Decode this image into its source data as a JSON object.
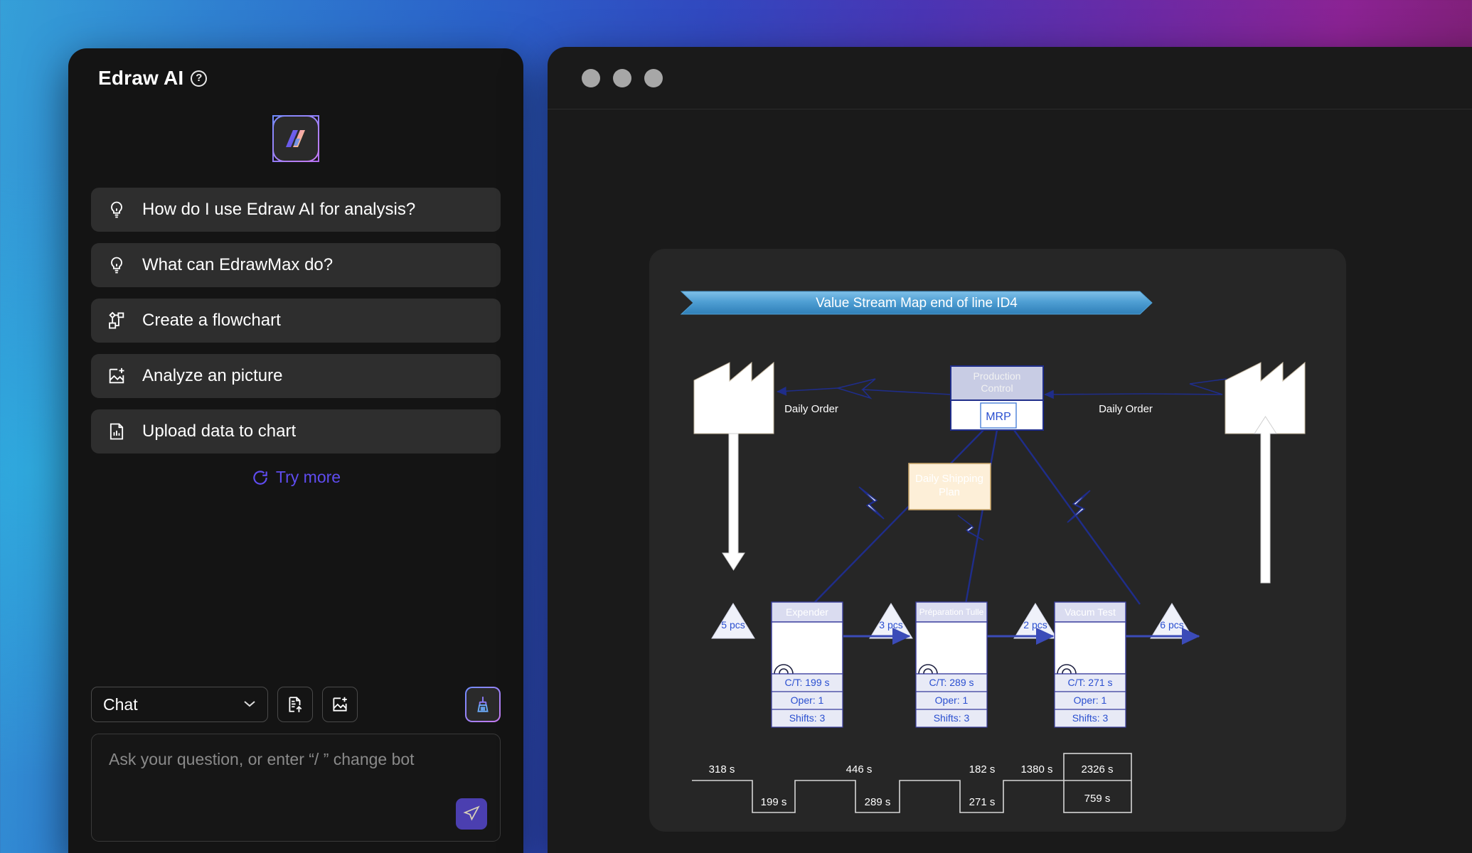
{
  "background": {
    "gradient_from": "#35a0d8",
    "gradient_mid": "#4a35b4",
    "gradient_to": "#5e1a50"
  },
  "ai_panel": {
    "title": "Edraw AI",
    "help_icon": "question-mark-icon",
    "logo_icon": "edraw-ai-logo-icon",
    "suggestions": [
      {
        "label": "How do I use Edraw AI for analysis?",
        "icon": "lightbulb-icon"
      },
      {
        "label": "What can EdrawMax do?",
        "icon": "lightbulb-icon"
      },
      {
        "label": "Create a flowchart",
        "icon": "flowchart-icon"
      },
      {
        "label": "Analyze an picture",
        "icon": "image-add-icon"
      },
      {
        "label": "Upload data to chart",
        "icon": "chart-file-icon"
      }
    ],
    "try_more": {
      "label": "Try more",
      "icon": "refresh-icon",
      "color": "#5f4cf0"
    },
    "controls": {
      "mode_select_value": "Chat",
      "chevron_icon": "chevron-down-icon",
      "upload_doc_icon": "file-upload-icon",
      "upload_image_icon": "image-add-icon",
      "clear_icon": "broom-icon"
    },
    "input": {
      "placeholder": "Ask your question, or enter  “/ ” change bot",
      "value": "",
      "send_icon": "send-icon"
    }
  },
  "doc_window": {
    "titlebar_dots": [
      "window-dot-1",
      "window-dot-2",
      "window-dot-3"
    ]
  },
  "chart_data": {
    "type": "diagram",
    "diagram_type": "value-stream-map",
    "title": "Value Stream Map end of line ID4",
    "title_banner_color": "#4f9fd4",
    "colors": {
      "process_header": "#dadcf0",
      "process_border": "#3b3f9e",
      "line": "#1f2d8a",
      "text_blue": "#2a4fd0",
      "shipping_plan_fill": "#fdefd8",
      "shipping_plan_border": "#c9a66b",
      "production_control_fill": "#c8cce4"
    },
    "control_box": {
      "title": "Production Control",
      "system": "MRP"
    },
    "shipping_plan": {
      "label": "Daily Shipping Plan"
    },
    "suppliers": [
      {
        "name": "supplier-factory",
        "side": "left",
        "icon": "factory-icon"
      },
      {
        "name": "customer-factory",
        "side": "right",
        "icon": "factory-icon"
      }
    ],
    "order_flows": [
      {
        "label": "Daily Order",
        "side": "left"
      },
      {
        "label": "Daily Order",
        "side": "right"
      }
    ],
    "inventories": [
      {
        "label": "5 pcs",
        "position": 0
      },
      {
        "label": "3 pcs",
        "position": 1
      },
      {
        "label": "2 pcs",
        "position": 2
      },
      {
        "label": "6 pcs",
        "position": 3
      }
    ],
    "processes": [
      {
        "name": "Expender",
        "ct": "C/T: 199 s",
        "oper": "Oper: 1",
        "shifts": "Shifts: 3"
      },
      {
        "name": "Préparation Tulle",
        "ct": "C/T: 289 s",
        "oper": "Oper: 1",
        "shifts": "Shifts: 3"
      },
      {
        "name": "Vacum Test",
        "ct": "C/T: 271 s",
        "oper": "Oper: 1",
        "shifts": "Shifts: 3"
      }
    ],
    "timeline": {
      "lead_times": [
        "318 s",
        "446 s",
        "182 s",
        "1380 s"
      ],
      "process_times": [
        "199 s",
        "289 s",
        "271 s"
      ],
      "total_lead_time": "2326 s",
      "total_process_time": "759 s"
    }
  }
}
